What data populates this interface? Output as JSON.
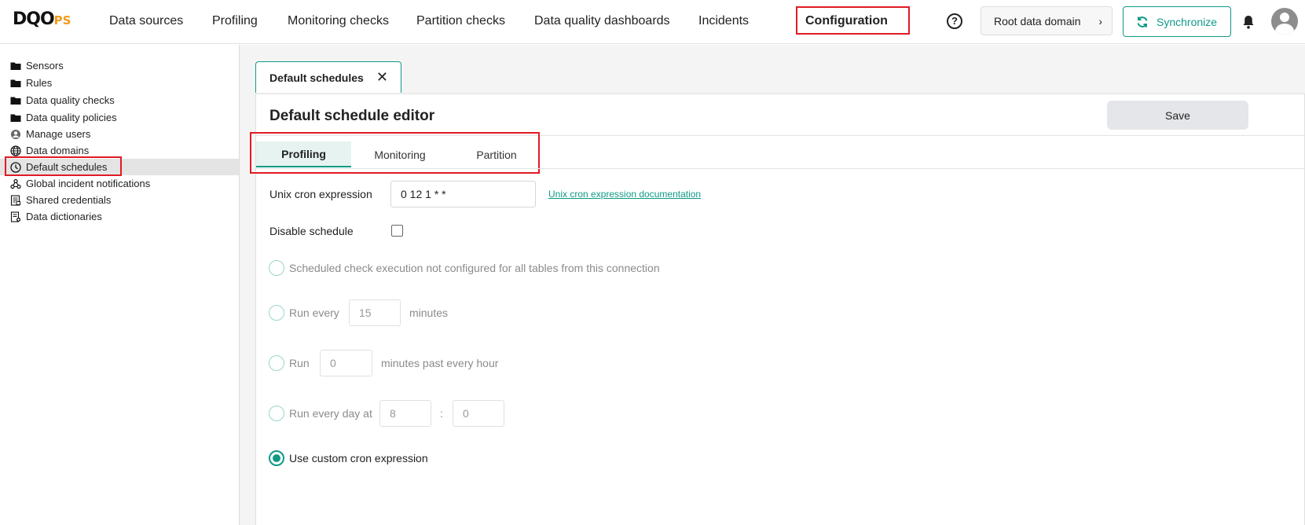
{
  "header": {
    "logo_main": "DQO",
    "logo_suffix": "PS",
    "nav": [
      {
        "label": "Data sources",
        "icon": "database-icon"
      },
      {
        "label": "Profiling",
        "icon": "profiling-icon"
      },
      {
        "label": "Monitoring checks",
        "icon": "monitoring-icon"
      },
      {
        "label": "Partition checks",
        "icon": "partition-icon"
      },
      {
        "label": "Data quality dashboards",
        "icon": "dashboard-icon"
      },
      {
        "label": "Incidents",
        "icon": "warning-icon"
      },
      {
        "label": "Configuration",
        "icon": "gear-icon"
      }
    ],
    "help": "?",
    "domain_label": "Root data domain",
    "sync_label": "Synchronize"
  },
  "sidebar": {
    "items": [
      {
        "label": "Sensors",
        "icon": "folder-icon"
      },
      {
        "label": "Rules",
        "icon": "folder-icon"
      },
      {
        "label": "Data quality checks",
        "icon": "folder-icon"
      },
      {
        "label": "Data quality policies",
        "icon": "folder-icon"
      },
      {
        "label": "Manage users",
        "icon": "user-icon"
      },
      {
        "label": "Data domains",
        "icon": "globe-icon"
      },
      {
        "label": "Default schedules",
        "icon": "clock-icon"
      },
      {
        "label": "Global incident notifications",
        "icon": "webhook-icon"
      },
      {
        "label": "Shared credentials",
        "icon": "credentials-icon"
      },
      {
        "label": "Data dictionaries",
        "icon": "dictionary-icon"
      }
    ]
  },
  "main": {
    "open_tab": "Default schedules",
    "title": "Default schedule editor",
    "save_label": "Save",
    "subtabs": [
      "Profiling",
      "Monitoring",
      "Partition"
    ],
    "cron_label": "Unix cron expression",
    "cron_value": "0 12 1 * *",
    "cron_doc_link": "Unix cron expression documentation",
    "disable_label": "Disable schedule",
    "options": {
      "not_configured": "Scheduled check execution not configured for all tables from this connection",
      "run_every": "Run every",
      "run_every_value": "15",
      "minutes": "minutes",
      "run": "Run",
      "run_value": "0",
      "minutes_past": "minutes past every hour",
      "run_daily": "Run every day at",
      "hour_value": "8",
      "colon": ":",
      "minute_value": "0",
      "custom": "Use custom cron expression"
    }
  },
  "colors": {
    "accent": "#0f9a86",
    "highlight": "#e01b24",
    "logo_accent": "#f39a1d"
  }
}
